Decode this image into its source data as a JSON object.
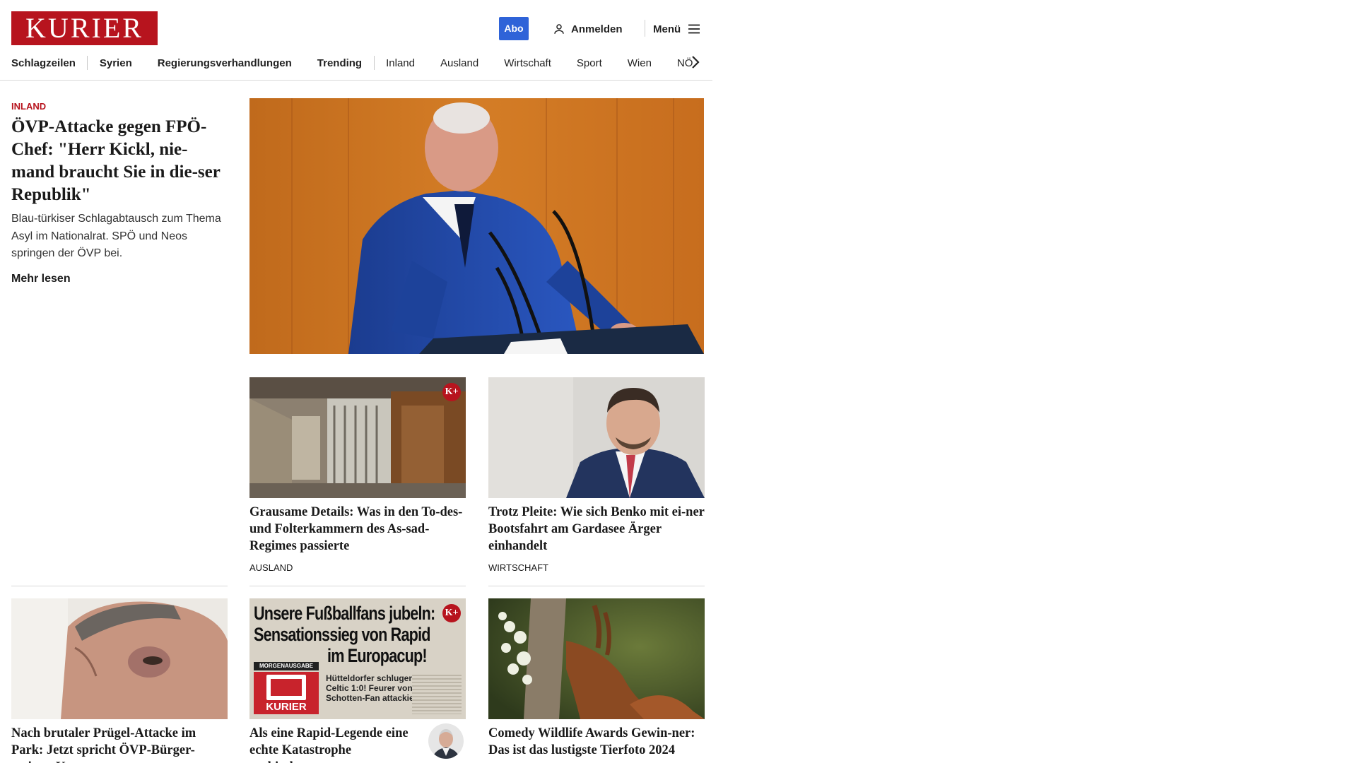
{
  "header": {
    "logo": "KURIER",
    "abo_label": "Abo",
    "login_label": "Anmelden",
    "menu_label": "Menü"
  },
  "nav": {
    "items": [
      "Schlagzeilen",
      "Syrien",
      "Regierungsverhandlungen",
      "Trending",
      "Inland",
      "Ausland",
      "Wirtschaft",
      "Sport",
      "Wien",
      "NÖ"
    ]
  },
  "lead": {
    "category": "INLAND",
    "title": "ÖVP-Attacke gegen FPÖ-Chef: \"Herr Kickl, nie-mand braucht Sie in die-ser Republik\"",
    "teaser": "Blau-türkiser Schlagabtausch zum Thema Asyl im Nationalrat. SPÖ und Neos springen der ÖVP bei.",
    "more": "Mehr lesen"
  },
  "cards": [
    {
      "title": "Grausame Details: Was in den To-des- und Folterkammern des As-sad-Regimes passierte",
      "category": "AUSLAND",
      "premium": "K+"
    },
    {
      "title": "Trotz Pleite: Wie sich Benko mit ei-ner Bootsfahrt am Gardasee Ärger einhandelt",
      "category": "WIRTSCHAFT"
    },
    {
      "title": "Nach brutaler Prügel-Attacke im Park: Jetzt spricht ÖVP-Bürger-meister Koza"
    },
    {
      "title": "Als eine Rapid-Legende eine echte Katastrophe verhinderte",
      "premium": "K+",
      "clipping": {
        "headline1": "Unsere Fußballfans jubeln:",
        "headline2": "Sensationssieg von Rapid",
        "headline3": "im Europacup!",
        "edition": "MORGENAUSGABE",
        "brand": "KURIER",
        "sub1": "Hütteldorfer schlugen",
        "sub2": "Celtic 1:0! Feurer von",
        "sub3": "Schotten-Fan attackiert"
      }
    },
    {
      "title": "Comedy Wildlife Awards Gewin-ner: Das ist das lustigste Tierfoto 2024"
    }
  ],
  "colors": {
    "brand_red": "#b7141e",
    "abo_blue": "#2f63d8"
  }
}
